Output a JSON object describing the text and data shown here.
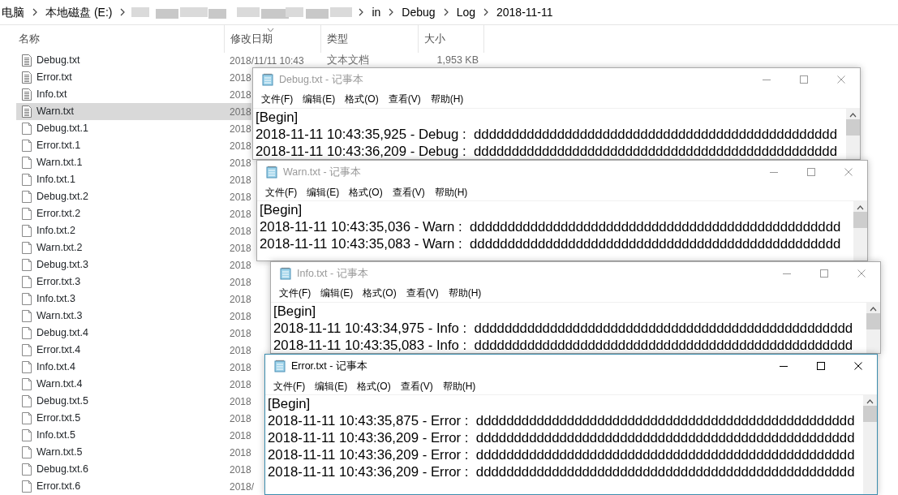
{
  "explorer": {
    "breadcrumb": [
      {
        "kind": "text",
        "label": "电脑"
      },
      {
        "kind": "text",
        "label": "本地磁盘 (E:)"
      },
      {
        "kind": "blurred"
      },
      {
        "kind": "text",
        "label": "in"
      },
      {
        "kind": "text",
        "label": "Debug"
      },
      {
        "kind": "text",
        "label": "Log"
      },
      {
        "kind": "text",
        "label": "2018-11-11"
      }
    ],
    "columns": [
      {
        "label": "名称",
        "sorted": false
      },
      {
        "label": "修改日期",
        "sorted": true
      },
      {
        "label": "类型",
        "sorted": false
      },
      {
        "label": "大小",
        "sorted": false
      }
    ],
    "files": [
      {
        "name": "Debug.txt",
        "kind": "text",
        "selected": false,
        "date": "2018/11/11 10:43",
        "type": "文本文档",
        "size": "1,953 KB"
      },
      {
        "name": "Error.txt",
        "kind": "text",
        "selected": false,
        "date": "2018"
      },
      {
        "name": "Info.txt",
        "kind": "text",
        "selected": false,
        "date": "2018"
      },
      {
        "name": "Warn.txt",
        "kind": "text",
        "selected": true,
        "date": "2018"
      },
      {
        "name": "Debug.txt.1",
        "kind": "blank",
        "selected": false,
        "date": "2018"
      },
      {
        "name": "Error.txt.1",
        "kind": "blank",
        "selected": false,
        "date": "2018"
      },
      {
        "name": "Warn.txt.1",
        "kind": "blank",
        "selected": false,
        "date": "2018"
      },
      {
        "name": "Info.txt.1",
        "kind": "blank",
        "selected": false,
        "date": "2018"
      },
      {
        "name": "Debug.txt.2",
        "kind": "blank",
        "selected": false,
        "date": "2018"
      },
      {
        "name": "Error.txt.2",
        "kind": "blank",
        "selected": false,
        "date": "2018"
      },
      {
        "name": "Info.txt.2",
        "kind": "blank",
        "selected": false,
        "date": "2018"
      },
      {
        "name": "Warn.txt.2",
        "kind": "blank",
        "selected": false,
        "date": "2018"
      },
      {
        "name": "Debug.txt.3",
        "kind": "blank",
        "selected": false,
        "date": "2018"
      },
      {
        "name": "Error.txt.3",
        "kind": "blank",
        "selected": false,
        "date": "2018"
      },
      {
        "name": "Info.txt.3",
        "kind": "blank",
        "selected": false,
        "date": "2018"
      },
      {
        "name": "Warn.txt.3",
        "kind": "blank",
        "selected": false,
        "date": "2018"
      },
      {
        "name": "Debug.txt.4",
        "kind": "blank",
        "selected": false,
        "date": "2018"
      },
      {
        "name": "Error.txt.4",
        "kind": "blank",
        "selected": false,
        "date": "2018"
      },
      {
        "name": "Info.txt.4",
        "kind": "blank",
        "selected": false,
        "date": "2018"
      },
      {
        "name": "Warn.txt.4",
        "kind": "blank",
        "selected": false,
        "date": "2018"
      },
      {
        "name": "Debug.txt.5",
        "kind": "blank",
        "selected": false,
        "date": "2018"
      },
      {
        "name": "Error.txt.5",
        "kind": "blank",
        "selected": false,
        "date": "2018"
      },
      {
        "name": "Info.txt.5",
        "kind": "blank",
        "selected": false,
        "date": "2018"
      },
      {
        "name": "Warn.txt.5",
        "kind": "blank",
        "selected": false,
        "date": "2018"
      },
      {
        "name": "Debug.txt.6",
        "kind": "blank",
        "selected": false,
        "date": "2018"
      },
      {
        "name": "Error.txt.6",
        "kind": "blank",
        "selected": false,
        "date": "2018/"
      }
    ]
  },
  "notepads": [
    {
      "title": "Debug.txt - 记事本",
      "active": false,
      "menu": [
        "文件(F)",
        "编辑(E)",
        "格式(O)",
        "查看(V)",
        "帮助(H)"
      ],
      "lines": [
        "[Begin]",
        "2018-11-11 10:43:35,925 - Debug :  dddddddddddddddddddddddddddddddddddddddddddddddd",
        "2018-11-11 10:43:36,209 - Debug :  dddddddddddddddddddddddddddddddddddddddddddddddd"
      ]
    },
    {
      "title": "Warn.txt - 记事本",
      "active": false,
      "menu": [
        "文件(F)",
        "编辑(E)",
        "格式(O)",
        "查看(V)",
        "帮助(H)"
      ],
      "lines": [
        "[Begin]",
        "2018-11-11 10:43:35,036 - Warn :  ddddddddddddddddddddddddddddddddddddddddddddddddd",
        "2018-11-11 10:43:35,083 - Warn :  ddddddddddddddddddddddddddddddddddddddddddddddddd"
      ]
    },
    {
      "title": "Info.txt - 记事本",
      "active": false,
      "menu": [
        "文件(F)",
        "编辑(E)",
        "格式(O)",
        "查看(V)",
        "帮助(H)"
      ],
      "lines": [
        "[Begin]",
        "2018-11-11 10:43:34,975 - Info :  dddddddddddddddddddddddddddddddddddddddddddddddddd",
        "2018-11-11 10:43:35,083 - Info :  dddddddddddddddddddddddddddddddddddddddddddddddddd"
      ]
    },
    {
      "title": "Error.txt - 记事本",
      "active": true,
      "menu": [
        "文件(F)",
        "编辑(E)",
        "格式(O)",
        "查看(V)",
        "帮助(H)"
      ],
      "lines": [
        "[Begin]",
        "2018-11-11 10:43:35,875 - Error :  dddddddddddddddddddddddddddddddddddddddddddddddddd",
        "2018-11-11 10:43:36,209 - Error :  dddddddddddddddddddddddddddddddddddddddddddddddddd",
        "2018-11-11 10:43:36,209 - Error :  dddddddddddddddddddddddddddddddddddddddddddddddddd",
        "2018-11-11 10:43:36,209 - Error :  dddddddddddddddddddddddddddddddddddddddddddddddddd"
      ]
    }
  ]
}
